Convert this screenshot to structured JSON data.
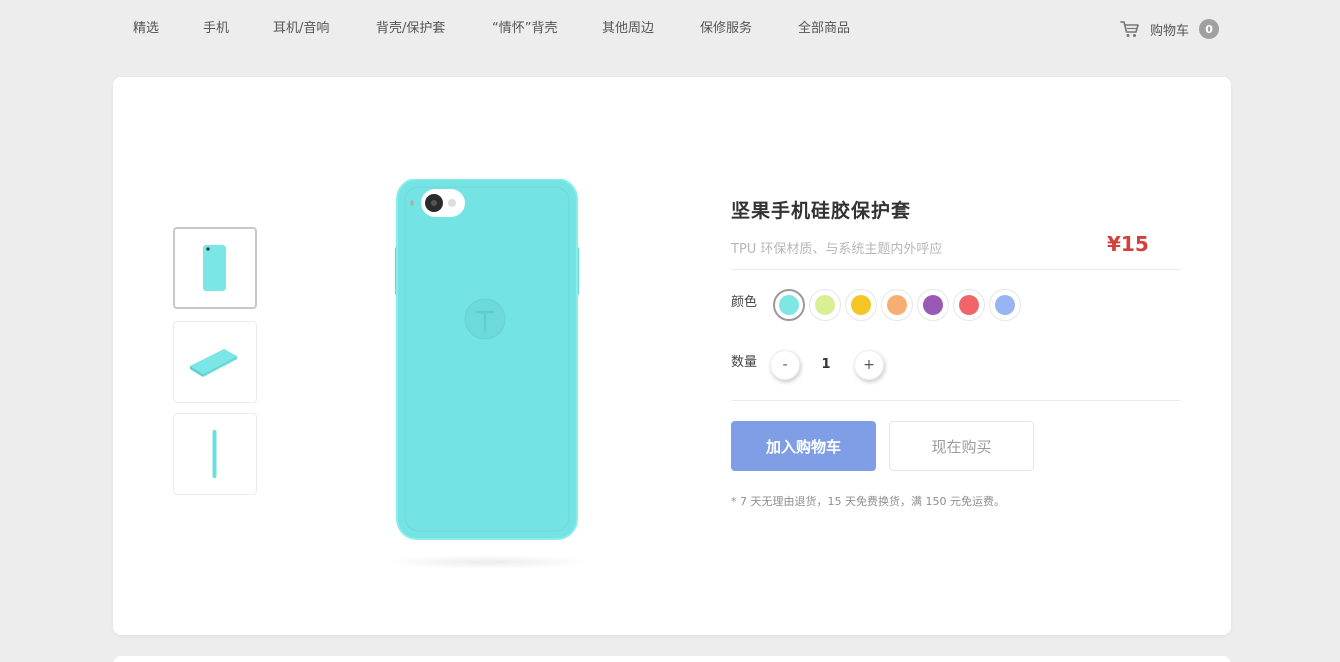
{
  "nav": {
    "items": [
      {
        "label": "精选"
      },
      {
        "label": "手机"
      },
      {
        "label": "耳机/音响"
      },
      {
        "label": "背壳/保护套"
      },
      {
        "label": "“情怀”背壳"
      },
      {
        "label": "其他周边"
      },
      {
        "label": "保修服务"
      },
      {
        "label": "全部商品"
      }
    ],
    "cart_label": "购物车",
    "cart_count": "0",
    "cart_icon": "cart-icon"
  },
  "product": {
    "title": "坚果手机硅胶保护套",
    "subtitle": "TPU 环保材质、与系统主题内外呼应",
    "price": "¥15",
    "color_label": "颜色",
    "colors": [
      "#7fe6e6",
      "#d9ef94",
      "#f5c626",
      "#f7ae73",
      "#9b59b6",
      "#f06569",
      "#97b4f3"
    ],
    "selected_color_index": 0,
    "quantity_label": "数量",
    "quantity_minus": "-",
    "quantity_value": "1",
    "quantity_plus": "+",
    "add_to_cart": "加入购物车",
    "buy_now": "现在购买",
    "note": "* 7 天无理由退货，15 天免费换货，满 150 元免运费。",
    "main_color": "#7ae6e6",
    "logo_icon": "t-logo-icon"
  }
}
